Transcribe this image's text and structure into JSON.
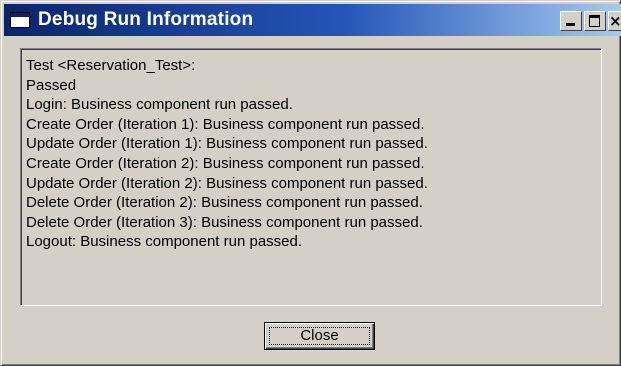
{
  "window": {
    "title": "Debug Run Information"
  },
  "title_buttons": {
    "close_glyph": "×"
  },
  "log": {
    "lines": [
      "Test <Reservation_Test>:",
      "Passed",
      "Login: Business component run passed.",
      "Create Order (Iteration 1): Business component run passed.",
      "Update Order (Iteration 1): Business component run passed.",
      "Create Order (Iteration 2): Business component run passed.",
      "Update Order (Iteration 2): Business component run passed.",
      "Delete Order (Iteration 2): Business component run passed.",
      "Delete Order (Iteration 3): Business component run passed.",
      "Logout: Business component run passed."
    ]
  },
  "buttons": {
    "close_label": "Close"
  },
  "icons": {
    "window": "window-app-icon",
    "minimize": "minimize-icon",
    "maximize": "maximize-icon",
    "close": "close-icon"
  },
  "colors": {
    "titlebar_start": "#0a246a",
    "titlebar_end": "#a6caf0",
    "face": "#d4d0c8",
    "text": "#000000"
  }
}
